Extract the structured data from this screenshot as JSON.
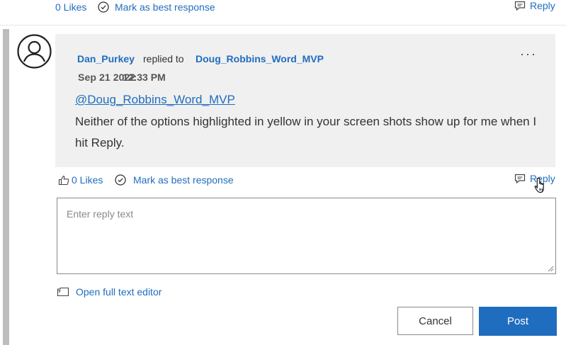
{
  "previous_post": {
    "likes_label": "0 Likes",
    "best_response_label": "Mark as best response",
    "reply_label": "Reply"
  },
  "reply": {
    "author": "Dan_Purkey",
    "replied_to_label": "replied to",
    "target_user": "Doug_Robbins_Word_MVP",
    "date": "Sep 21 2022",
    "time": "12:33 PM",
    "menu": "···",
    "mention": "@Doug_Robbins_Word_MVP",
    "body": "Neither of the options highlighted in yellow in your screen shots show up for me when I hit Reply.",
    "likes_label": "0 Likes",
    "best_response_label": "Mark as best response",
    "reply_label": "Reply"
  },
  "composer": {
    "placeholder": "Enter reply text",
    "full_editor_label": "Open full text editor",
    "cancel_label": "Cancel",
    "post_label": "Post"
  },
  "colors": {
    "link": "#1f6dbf",
    "card_bg": "#f0f0f0",
    "primary_button": "#1f6dbf",
    "thread_rail": "#bdbdbd"
  },
  "icons": [
    "checkmark-circle-icon",
    "comment-icon",
    "thumbs-up-icon",
    "avatar-icon",
    "more-options-icon",
    "editor-icon",
    "hand-cursor-icon",
    "resize-grip-icon"
  ]
}
